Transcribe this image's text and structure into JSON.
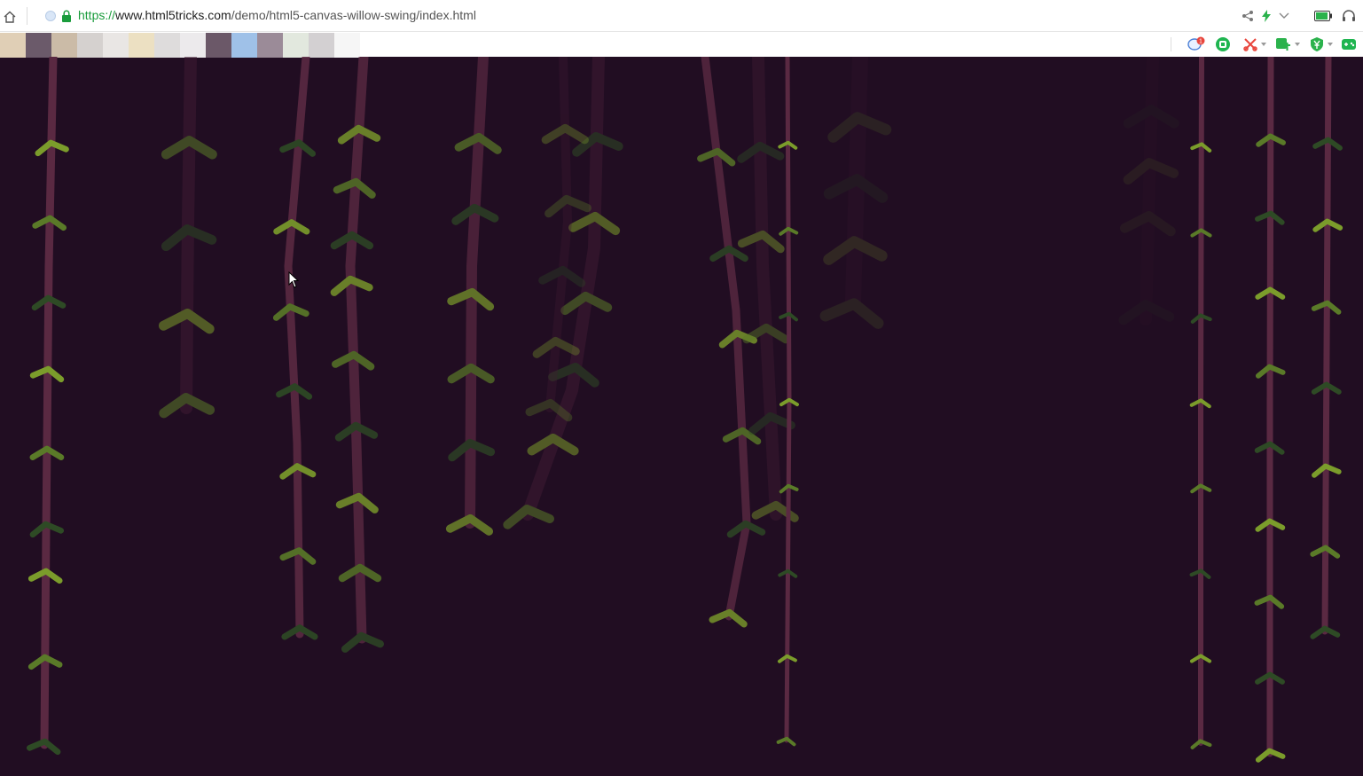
{
  "browser": {
    "url": {
      "protocol": "https://",
      "host": "www.html5tricks.com",
      "path": "/demo/html5-canvas-willow-swing/index.html"
    },
    "icons": {
      "home": "home-icon",
      "site": "site-favicon-icon",
      "lock": "lock-icon",
      "share": "share-icon",
      "bolt": "lightning-icon",
      "dropdown": "chevron-down-icon",
      "battery": "battery-icon",
      "headphones": "headphones-icon"
    },
    "extensions": [
      "chat-bubble-icon",
      "green-circle-icon",
      "scissors-icon",
      "translate-icon",
      "currency-icon",
      "gamepad-icon"
    ],
    "extension_badge": "1"
  },
  "bookmark_swatches": [
    "#e0cfb6",
    "#6b5a6a",
    "#cbbba7",
    "#d5d1cf",
    "#e9e6e4",
    "#ece0c2",
    "#dedcdc",
    "#eceaec",
    "#6b5868",
    "#9fc1e8",
    "#9b8b98",
    "#e2e8de",
    "#d3d0d2",
    "#f6f6f6"
  ],
  "colors": {
    "background": "#210d22",
    "stem": "#5a2942",
    "stem_dark": "#3f1b33",
    "leaf_light": "#7b9c2b",
    "leaf_mid": "#5a7a28",
    "leaf_dark": "#2e4a25"
  }
}
